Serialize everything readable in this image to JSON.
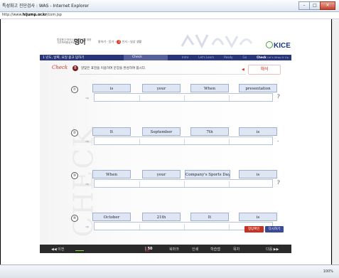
{
  "window": {
    "title": "특성화고 진단검사 : WAS - Internet Explorer",
    "buttons": {
      "min": "–",
      "max": "□",
      "close": "✕"
    }
  },
  "address": {
    "prefix": "http://www.",
    "host": "hijump.or.kr",
    "path": "/com.jsp"
  },
  "header": {
    "school_line1": "특성화고·마이스터고 학생을 위한",
    "school_line2": "기초학력향상프로그램",
    "subject": "영어",
    "crumb_pre": "말하기 · 듣기 ›",
    "crumb_num": "3",
    "crumb_mid": "인사",
    "crumb_post": "› 일상 생활",
    "brand": "KICE"
  },
  "navbar": {
    "lesson": "1   년도, 날짜, 요일 묻고 답하기",
    "check_tab": "Check",
    "steps": [
      "Intro",
      "Let's Learn",
      "Ready",
      "Go",
      "Check"
    ],
    "active_step": "Check",
    "wrap": "Let's Wrap It Up"
  },
  "exercise": {
    "logo": "Check",
    "question_number": "B",
    "instruction": "알맞은 표현을 이용하여 문장을 완성하여 봅시다.",
    "explain_button": "해석",
    "watermark": "CHECK",
    "rows": [
      {
        "num": "①",
        "words": [
          "is",
          "your",
          "When",
          "presentation"
        ],
        "punct": "?"
      },
      {
        "num": "②",
        "words": [
          "It",
          "September",
          "7th",
          "is"
        ],
        "punct": "."
      },
      {
        "num": "③",
        "words": [
          "When",
          "your",
          "Company's Sports Day",
          "is"
        ],
        "punct": "?"
      },
      {
        "num": "④",
        "words": [
          "October",
          "21th",
          "It",
          "is"
        ],
        "punct": "."
      }
    ],
    "arrow": "⇒",
    "confirm_button": "정답확인",
    "retry_button": "다시하기"
  },
  "bottombar": {
    "prev": "◀◀ 이전",
    "page_current": "16",
    "page_sep": " | ",
    "page_total": "50",
    "bookmark": "북마크",
    "print": "인쇄",
    "history": "학습맵",
    "index": "목차",
    "next": "다음 ▶▶"
  },
  "status": {
    "zoom": "100%"
  }
}
